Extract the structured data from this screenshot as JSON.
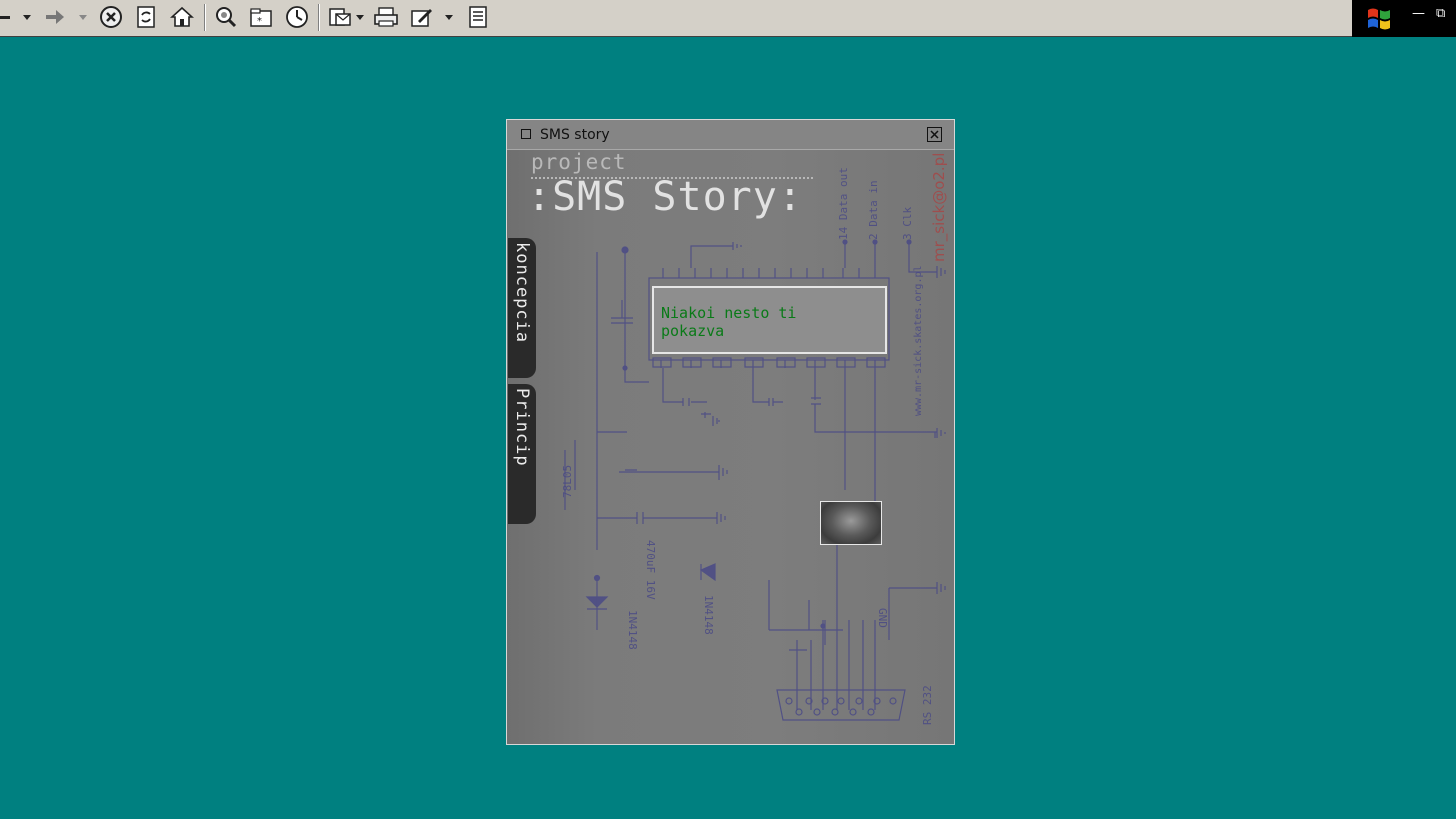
{
  "popup": {
    "title": "SMS story",
    "project_label": "project",
    "main_title": ":SMS Story:",
    "tabs": [
      {
        "label": "koncepcia"
      },
      {
        "label": "Princip"
      }
    ],
    "display_text_line1": "Niakoi nesto ti",
    "display_text_line2": "pokazva",
    "credit_text": "mr_sick@o2.pl",
    "website_text": "www.mr-sick.skates.org.pl"
  },
  "schematic_labels": {
    "pin14": "14 Data out",
    "pin2": "2 Data in",
    "pin3": "3 Clk",
    "reg": "78L05",
    "diode1": "1N4148",
    "diode2": "1N4148",
    "cap1": "470uF 16V",
    "port": "RS 232",
    "gnd": "GND"
  }
}
